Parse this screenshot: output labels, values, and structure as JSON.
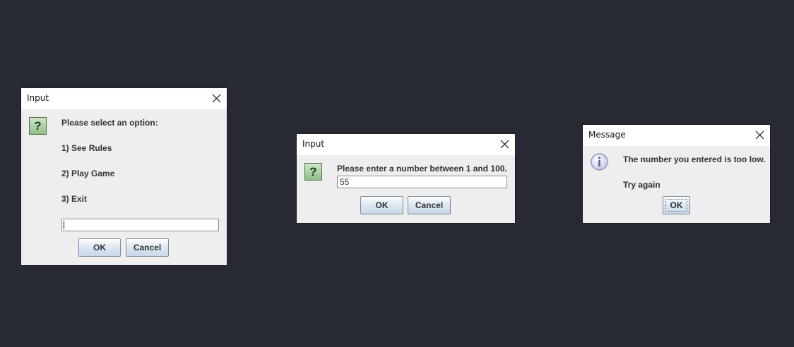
{
  "dialogs": {
    "menu": {
      "title": "Input",
      "prompt": "Please select an option:",
      "options": [
        "1) See Rules",
        "2) Play Game",
        "3) Exit"
      ],
      "input_value": "",
      "ok_label": "OK",
      "cancel_label": "Cancel",
      "icon": "question-icon"
    },
    "number": {
      "title": "Input",
      "prompt": "Please enter a number between 1 and 100.",
      "input_value": "55",
      "ok_label": "OK",
      "cancel_label": "Cancel",
      "icon": "question-icon"
    },
    "message": {
      "title": "Message",
      "line1": "The number you entered is too low.",
      "line2": "Try again",
      "ok_label": "OK",
      "icon": "info-icon"
    }
  },
  "colors": {
    "desktop": "#272a33",
    "dialog_bg": "#eeeeee",
    "titlebar": "#ffffff"
  }
}
